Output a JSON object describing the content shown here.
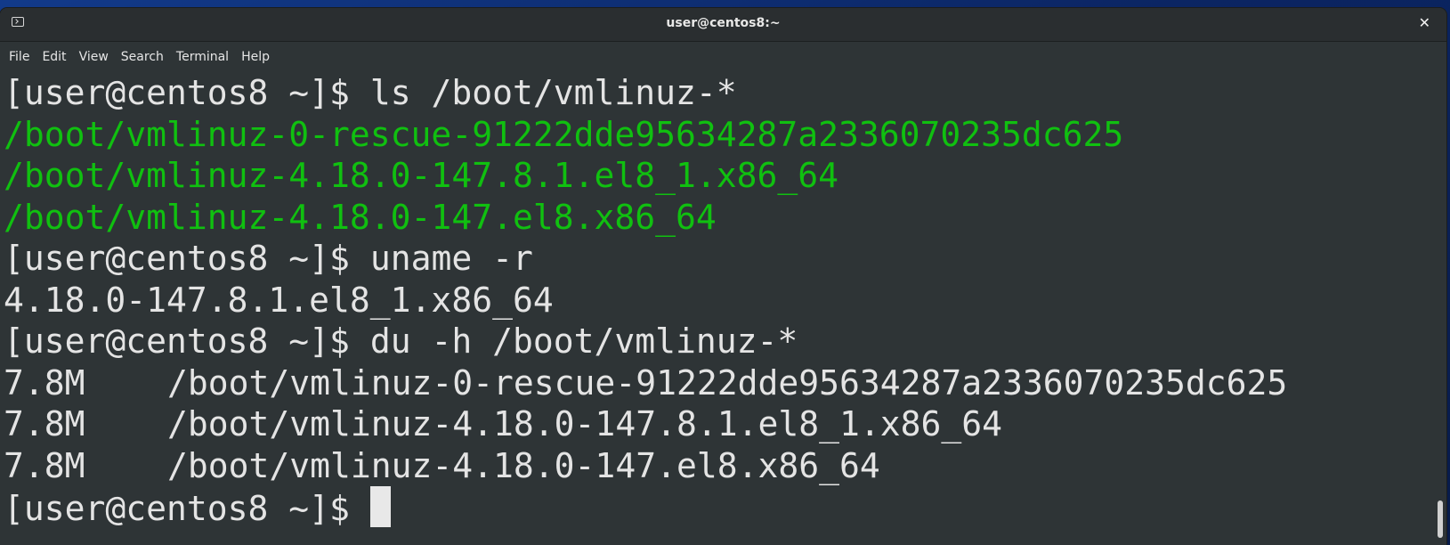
{
  "window": {
    "title": "user@centos8:~",
    "close_label": "✕"
  },
  "menu": {
    "items": [
      "File",
      "Edit",
      "View",
      "Search",
      "Terminal",
      "Help"
    ]
  },
  "terminal": {
    "prompt": "[user@centos8 ~]$ ",
    "commands": {
      "ls": "ls /boot/vmlinuz-*",
      "uname": "uname -r",
      "du": "du -h /boot/vmlinuz-*"
    },
    "ls_output": [
      "/boot/vmlinuz-0-rescue-91222dde95634287a2336070235dc625",
      "/boot/vmlinuz-4.18.0-147.8.1.el8_1.x86_64",
      "/boot/vmlinuz-4.18.0-147.el8.x86_64"
    ],
    "uname_output": "4.18.0-147.8.1.el8_1.x86_64",
    "du_output": [
      {
        "size": "7.8M",
        "path": "/boot/vmlinuz-0-rescue-91222dde95634287a2336070235dc625"
      },
      {
        "size": "7.8M",
        "path": "/boot/vmlinuz-4.18.0-147.8.1.el8_1.x86_64"
      },
      {
        "size": "7.8M",
        "path": "/boot/vmlinuz-4.18.0-147.el8.x86_64"
      }
    ]
  },
  "colors": {
    "file_highlight": "#10c010",
    "foreground": "#e4e4e4",
    "background": "#2e3436"
  }
}
